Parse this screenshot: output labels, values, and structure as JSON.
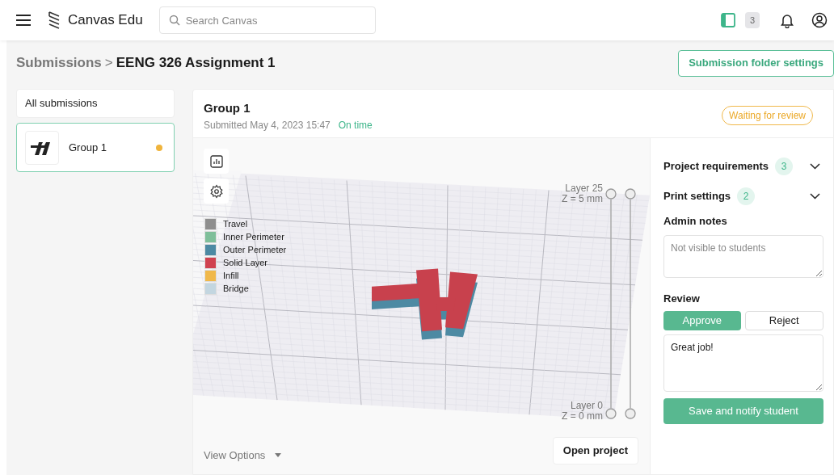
{
  "header": {
    "brand": "Canvas Edu",
    "search": {
      "placeholder": "Search Canvas"
    },
    "panel_count": "3"
  },
  "breadcrumb": {
    "parent": "Submissions",
    "separator": ">",
    "current": "EENG 326 Assignment 1"
  },
  "folder_settings_button": "Submission folder settings",
  "sidebar": {
    "all_label": "All submissions",
    "items": [
      {
        "name": "Group 1",
        "selected": true,
        "color": "#f0b43c"
      }
    ]
  },
  "submission": {
    "title": "Group 1",
    "submitted": "Submitted May 4, 2023 15:47",
    "timeliness": "On time",
    "status": "Waiting for review"
  },
  "viewer": {
    "legend": [
      {
        "label": "Travel",
        "color": "#8e8e8e"
      },
      {
        "label": "Inner Perimeter",
        "color": "#7fbf9a"
      },
      {
        "label": "Outer Perimeter",
        "color": "#4d8aa3"
      },
      {
        "label": "Solid Layer",
        "color": "#d0424f"
      },
      {
        "label": "Infill",
        "color": "#f0b84a"
      },
      {
        "label": "Bridge",
        "color": "#c3d6e0"
      }
    ],
    "top_layer": {
      "layer": "Layer 25",
      "z": "Z = 5 mm"
    },
    "bottom_layer": {
      "layer": "Layer 0",
      "z": "Z = 0 mm"
    },
    "view_options": "View Options",
    "open_project": "Open project"
  },
  "details": {
    "sections": [
      {
        "title": "Project requirements",
        "count": "3",
        "expanded": false
      },
      {
        "title": "Print settings",
        "count": "2",
        "expanded": false
      }
    ],
    "admin_notes": {
      "label": "Admin notes",
      "placeholder": "Not visible to students"
    },
    "review": {
      "label": "Review",
      "options": [
        {
          "label": "Approve",
          "selected": true
        },
        {
          "label": "Reject",
          "selected": false
        }
      ],
      "comment": "Great job!",
      "submit": "Save and notify student"
    }
  }
}
